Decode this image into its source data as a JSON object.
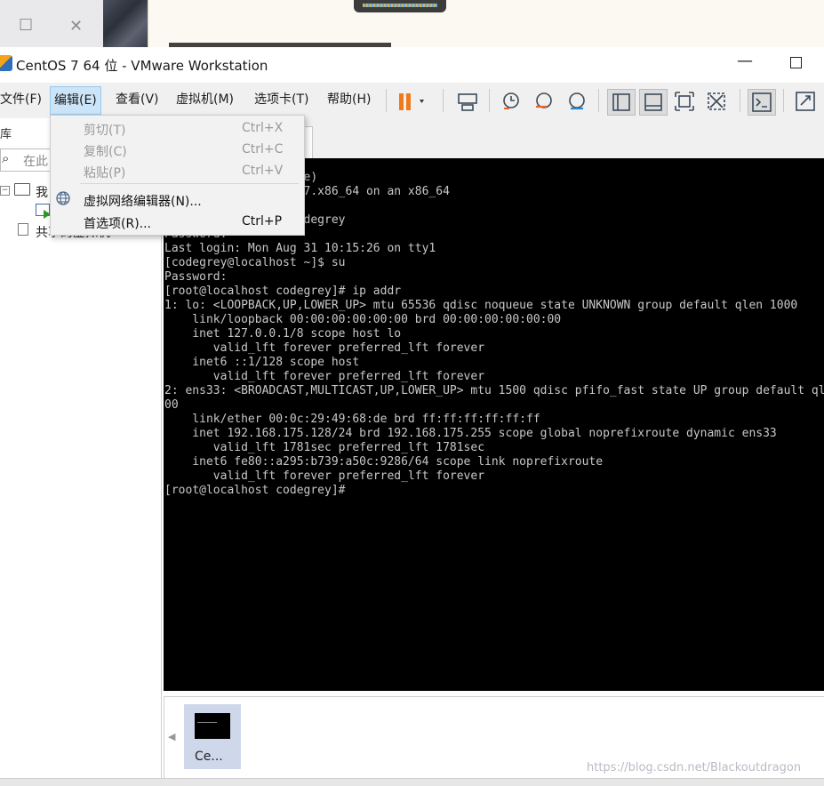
{
  "window": {
    "title": "CentOS 7 64 位 - VMware Workstation",
    "minimize_glyph": "—",
    "bg_controls": {
      "restore_glyph": "☐",
      "close_glyph": "✕"
    }
  },
  "menubar": {
    "items": [
      {
        "label": "文件(F)"
      },
      {
        "label": "编辑(E)",
        "active": true
      },
      {
        "label": "查看(V)"
      },
      {
        "label": "虚拟机(M)"
      },
      {
        "label": "选项卡(T)"
      },
      {
        "label": "帮助(H)"
      }
    ],
    "toolbar_icons": [
      "pause-icon",
      "send-keys-icon",
      "snapshot-icon",
      "revert-snapshot-icon",
      "snapshot-manager-icon",
      "library-view-icon",
      "thumbnail-view-icon",
      "fullscreen-icon",
      "unity-icon",
      "console-view-icon",
      "stretch-icon"
    ],
    "colors": {
      "pause": "#f07a1a",
      "menu_active_bg": "#cce4f7"
    }
  },
  "edit_menu": {
    "items": [
      {
        "label": "剪切(T)",
        "accel": "Ctrl+X",
        "enabled": false
      },
      {
        "label": "复制(C)",
        "accel": "Ctrl+C",
        "enabled": false
      },
      {
        "label": "粘贴(P)",
        "accel": "Ctrl+V",
        "enabled": false
      },
      {
        "label": "虚拟网络编辑器(N)...",
        "accel": "",
        "enabled": true,
        "icon": "globe-icon"
      },
      {
        "label": "首选项(R)...",
        "accel": "Ctrl+P",
        "enabled": true
      }
    ]
  },
  "library": {
    "header": "库",
    "search_placeholder": "在此",
    "tree": {
      "my_computer": "我",
      "shared": "共享的虚拟机"
    }
  },
  "console": {
    "lines": [
      "                    e)",
      "                  el7.x86_64 on an x86_64",
      "",
      "                    degrey",
      "Password:",
      "Last login: Mon Aug 31 10:15:26 on tty1",
      "[codegrey@localhost ~]$ su",
      "Password:",
      "[root@localhost codegrey]# ip addr",
      "1: lo: <LOOPBACK,UP,LOWER_UP> mtu 65536 qdisc noqueue state UNKNOWN group default qlen 1000",
      "    link/loopback 00:00:00:00:00:00 brd 00:00:00:00:00:00",
      "    inet 127.0.0.1/8 scope host lo",
      "       valid_lft forever preferred_lft forever",
      "    inet6 ::1/128 scope host",
      "       valid_lft forever preferred_lft forever",
      "2: ens33: <BROADCAST,MULTICAST,UP,LOWER_UP> mtu 1500 qdisc pfifo_fast state UP group default qlen 10",
      "00",
      "    link/ether 00:0c:29:49:68:de brd ff:ff:ff:ff:ff:ff",
      "    inet 192.168.175.128/24 brd 192.168.175.255 scope global noprefixroute dynamic ens33",
      "       valid_lft 1781sec preferred_lft 1781sec",
      "    inet6 fe80::a295:b739:a50c:9286/64 scope link noprefixroute",
      "       valid_lft forever preferred_lft forever",
      "[root@localhost codegrey]#"
    ]
  },
  "thumbnail": {
    "label": "Ce..."
  },
  "watermark": "https://blog.csdn.net/Blackoutdragon"
}
